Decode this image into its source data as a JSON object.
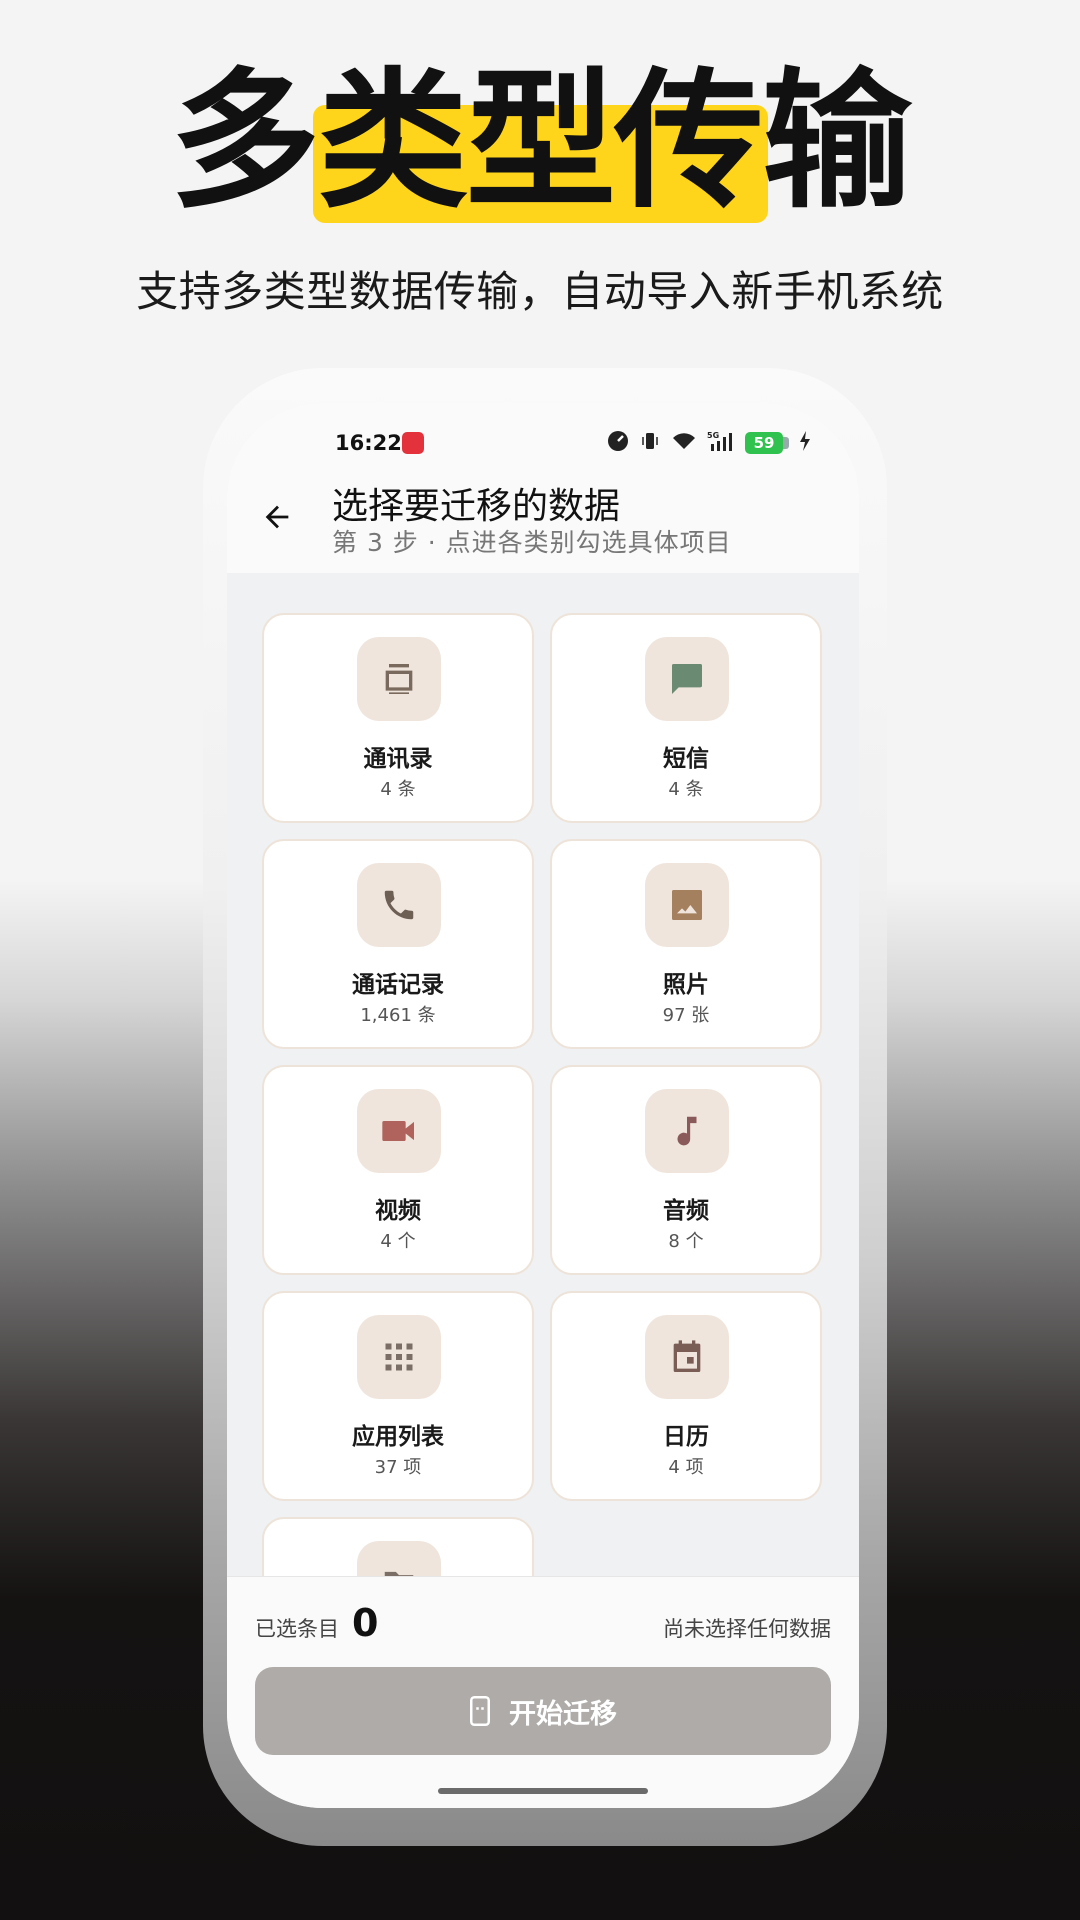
{
  "hero": {
    "title": "多类型传输",
    "subtitle": "支持多类型数据传输，自动导入新手机系统"
  },
  "status_bar": {
    "time": "16:22",
    "network": "5G",
    "battery": "59"
  },
  "header": {
    "title": "选择要迁移的数据",
    "subtitle": "第 3 步 · 点进各类别勾选具体项目"
  },
  "categories": [
    {
      "label": "通讯录",
      "count": "4 条",
      "icon": "contacts-icon",
      "color": "#7a6a5e"
    },
    {
      "label": "短信",
      "count": "4 条",
      "icon": "message-icon",
      "color": "#6b8a72"
    },
    {
      "label": "通话记录",
      "count": "1,461 条",
      "icon": "phone-icon",
      "color": "#6e5f55"
    },
    {
      "label": "照片",
      "count": "97 张",
      "icon": "photo-icon",
      "color": "#a4805e"
    },
    {
      "label": "视频",
      "count": "4 个",
      "icon": "video-icon",
      "color": "#b0635d"
    },
    {
      "label": "音频",
      "count": "8 个",
      "icon": "music-icon",
      "color": "#8a5a5a"
    },
    {
      "label": "应用列表",
      "count": "37 项",
      "icon": "apps-grid-icon",
      "color": "#7a6e66"
    },
    {
      "label": "日历",
      "count": "4 项",
      "icon": "calendar-icon",
      "color": "#7a5e55"
    },
    {
      "label": "",
      "count": "",
      "icon": "folder-icon",
      "color": "#7a6e66"
    }
  ],
  "bottom": {
    "selected_label": "已选条目",
    "selected_count": "0",
    "status_text": "尚未选择任何数据",
    "start_button": "开始迁移"
  }
}
